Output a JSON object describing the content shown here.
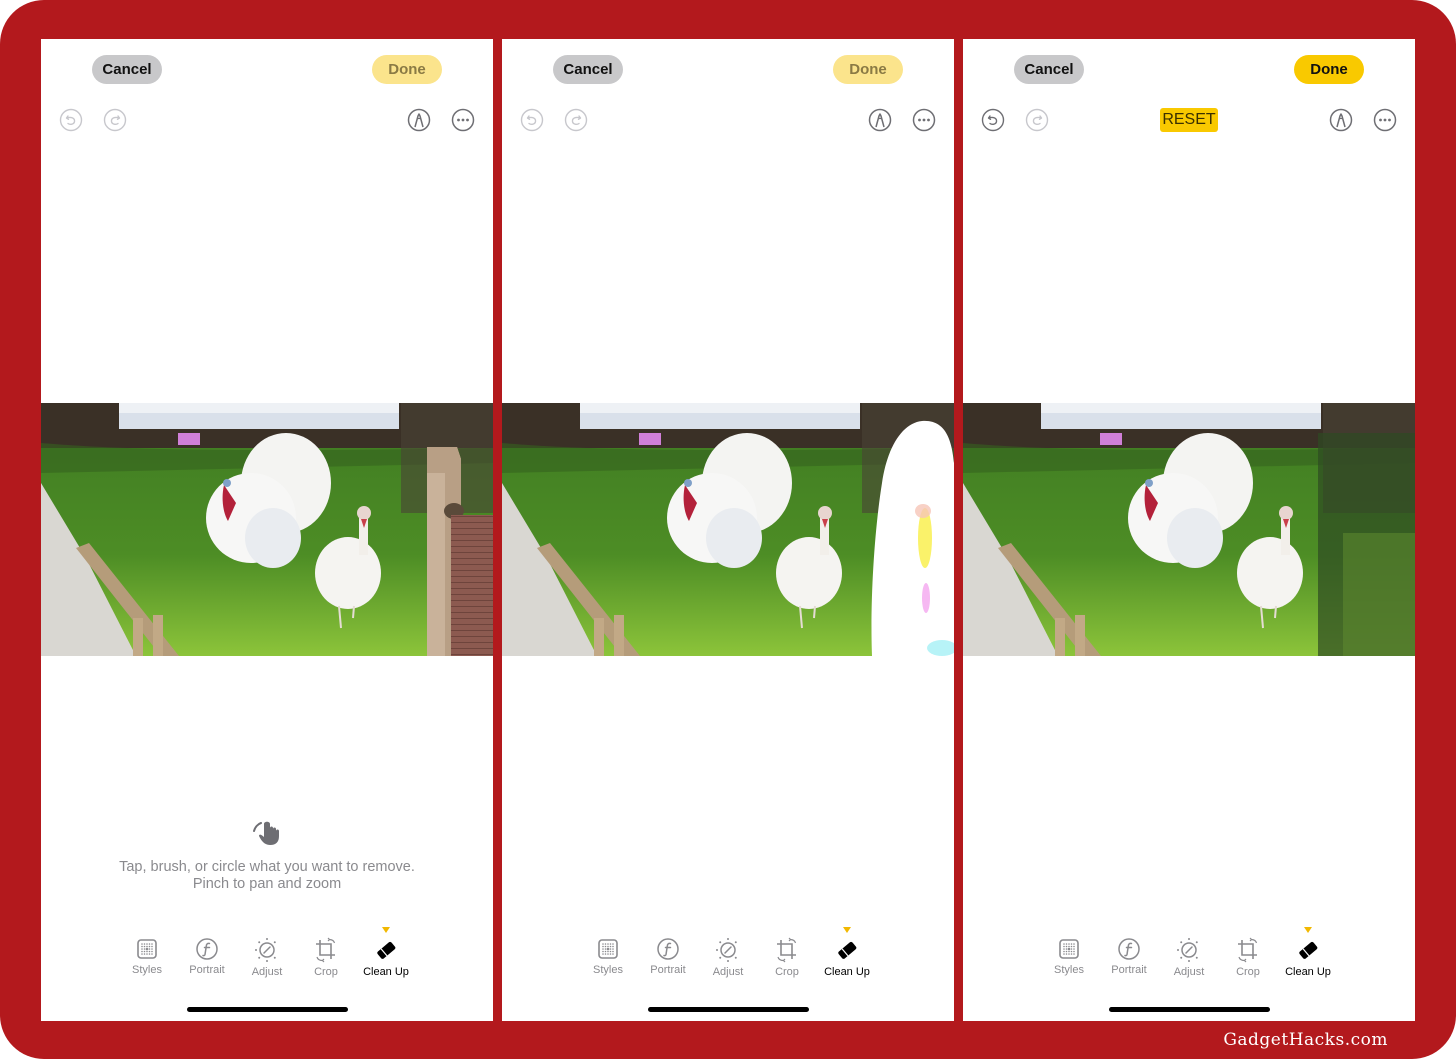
{
  "watermark": "GadgetHacks.com",
  "panels": [
    {
      "cancel_label": "Cancel",
      "done_label": "Done",
      "done_state": "disabled",
      "undo_enabled": false,
      "redo_enabled": false,
      "reset_label": null,
      "photo_state": "original-with-fence-post",
      "hint_icon": "hand-tap-icon",
      "hint_line1": "Tap, brush, or circle what you want to remove.",
      "hint_line2": "Pinch to pan and zoom"
    },
    {
      "cancel_label": "Cancel",
      "done_label": "Done",
      "done_state": "disabled",
      "undo_enabled": false,
      "redo_enabled": false,
      "reset_label": null,
      "photo_state": "fence-post-brushed-selection"
    },
    {
      "cancel_label": "Cancel",
      "done_label": "Done",
      "done_state": "enabled",
      "undo_enabled": true,
      "redo_enabled": false,
      "reset_label": "RESET",
      "photo_state": "fence-post-removed"
    }
  ],
  "toolbar": {
    "items": [
      {
        "label": "Styles",
        "icon": "styles-grid-icon"
      },
      {
        "label": "Portrait",
        "icon": "portrait-f-icon"
      },
      {
        "label": "Adjust",
        "icon": "adjust-dial-icon"
      },
      {
        "label": "Crop",
        "icon": "crop-rotate-icon"
      },
      {
        "label": "Clean Up",
        "icon": "eraser-icon",
        "active": true
      }
    ]
  },
  "colors": {
    "frame": "#b3191d",
    "accent_yellow": "#f9c900",
    "done_disabled": "#fbe48c",
    "cancel_bg": "#c8c8ca",
    "inactive_text": "#8a8a8e"
  }
}
